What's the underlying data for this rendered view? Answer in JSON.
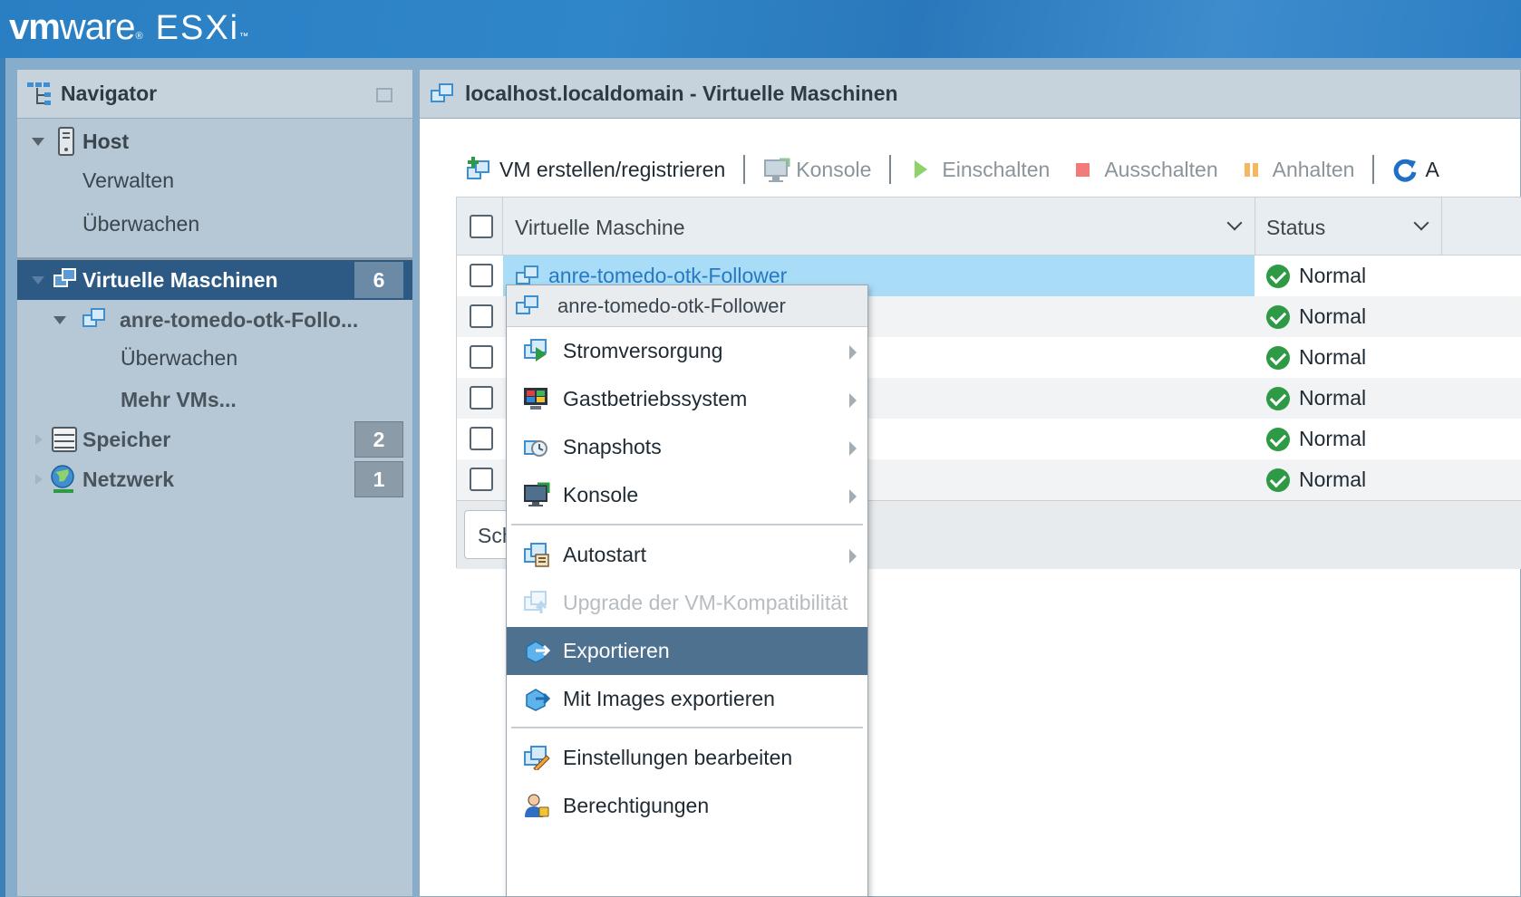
{
  "brand": {
    "vm": "vm",
    "ware": "ware",
    "reg": "®",
    "product": "ESXi",
    "tm": "™"
  },
  "navigator": {
    "title": "Navigator",
    "host": {
      "label": "Host",
      "children": [
        "Verwalten",
        "Überwachen"
      ]
    },
    "vms": {
      "label": "Virtuelle Maschinen",
      "count": "6"
    },
    "vm_node": {
      "label": "anre-tomedo-otk-Follo...",
      "children": [
        "Überwachen",
        "Mehr VMs..."
      ]
    },
    "storage": {
      "label": "Speicher",
      "count": "2"
    },
    "network": {
      "label": "Netzwerk",
      "count": "1"
    }
  },
  "main": {
    "title": "localhost.localdomain - Virtuelle Maschinen",
    "toolbar": {
      "create": "VM erstellen/registrieren",
      "console": "Konsole",
      "power_on": "Einschalten",
      "power_off": "Ausschalten",
      "suspend": "Anhalten",
      "refresh_partial": "A"
    },
    "grid": {
      "columns": [
        "Virtuelle Maschine",
        "Status"
      ],
      "rows": [
        {
          "name": "anre-tomedo-otk-Follower",
          "status": "Normal"
        },
        {
          "name": "",
          "status": "Normal"
        },
        {
          "name": "",
          "status": "Normal"
        },
        {
          "name": "",
          "status": "Normal"
        },
        {
          "name": "",
          "status": "Normal"
        },
        {
          "name": "",
          "status": "Normal"
        }
      ],
      "search_placeholder": "Schne"
    }
  },
  "context_menu": {
    "header": "anre-tomedo-otk-Follower",
    "items": [
      "Stromversorgung",
      "Gastbetriebssystem",
      "Snapshots",
      "Konsole",
      "Autostart",
      "Upgrade der VM-Kompatibilität",
      "Exportieren",
      "Mit Images exportieren",
      "Einstellungen bearbeiten",
      "Berechtigungen"
    ]
  },
  "colors": {
    "banner": "#2a7fc3",
    "nav_selected": "#2d5a85",
    "row_selected": "#a9dcf7",
    "menu_active": "#4e7190",
    "status_ok": "#2e9a45",
    "link": "#2779c2"
  }
}
